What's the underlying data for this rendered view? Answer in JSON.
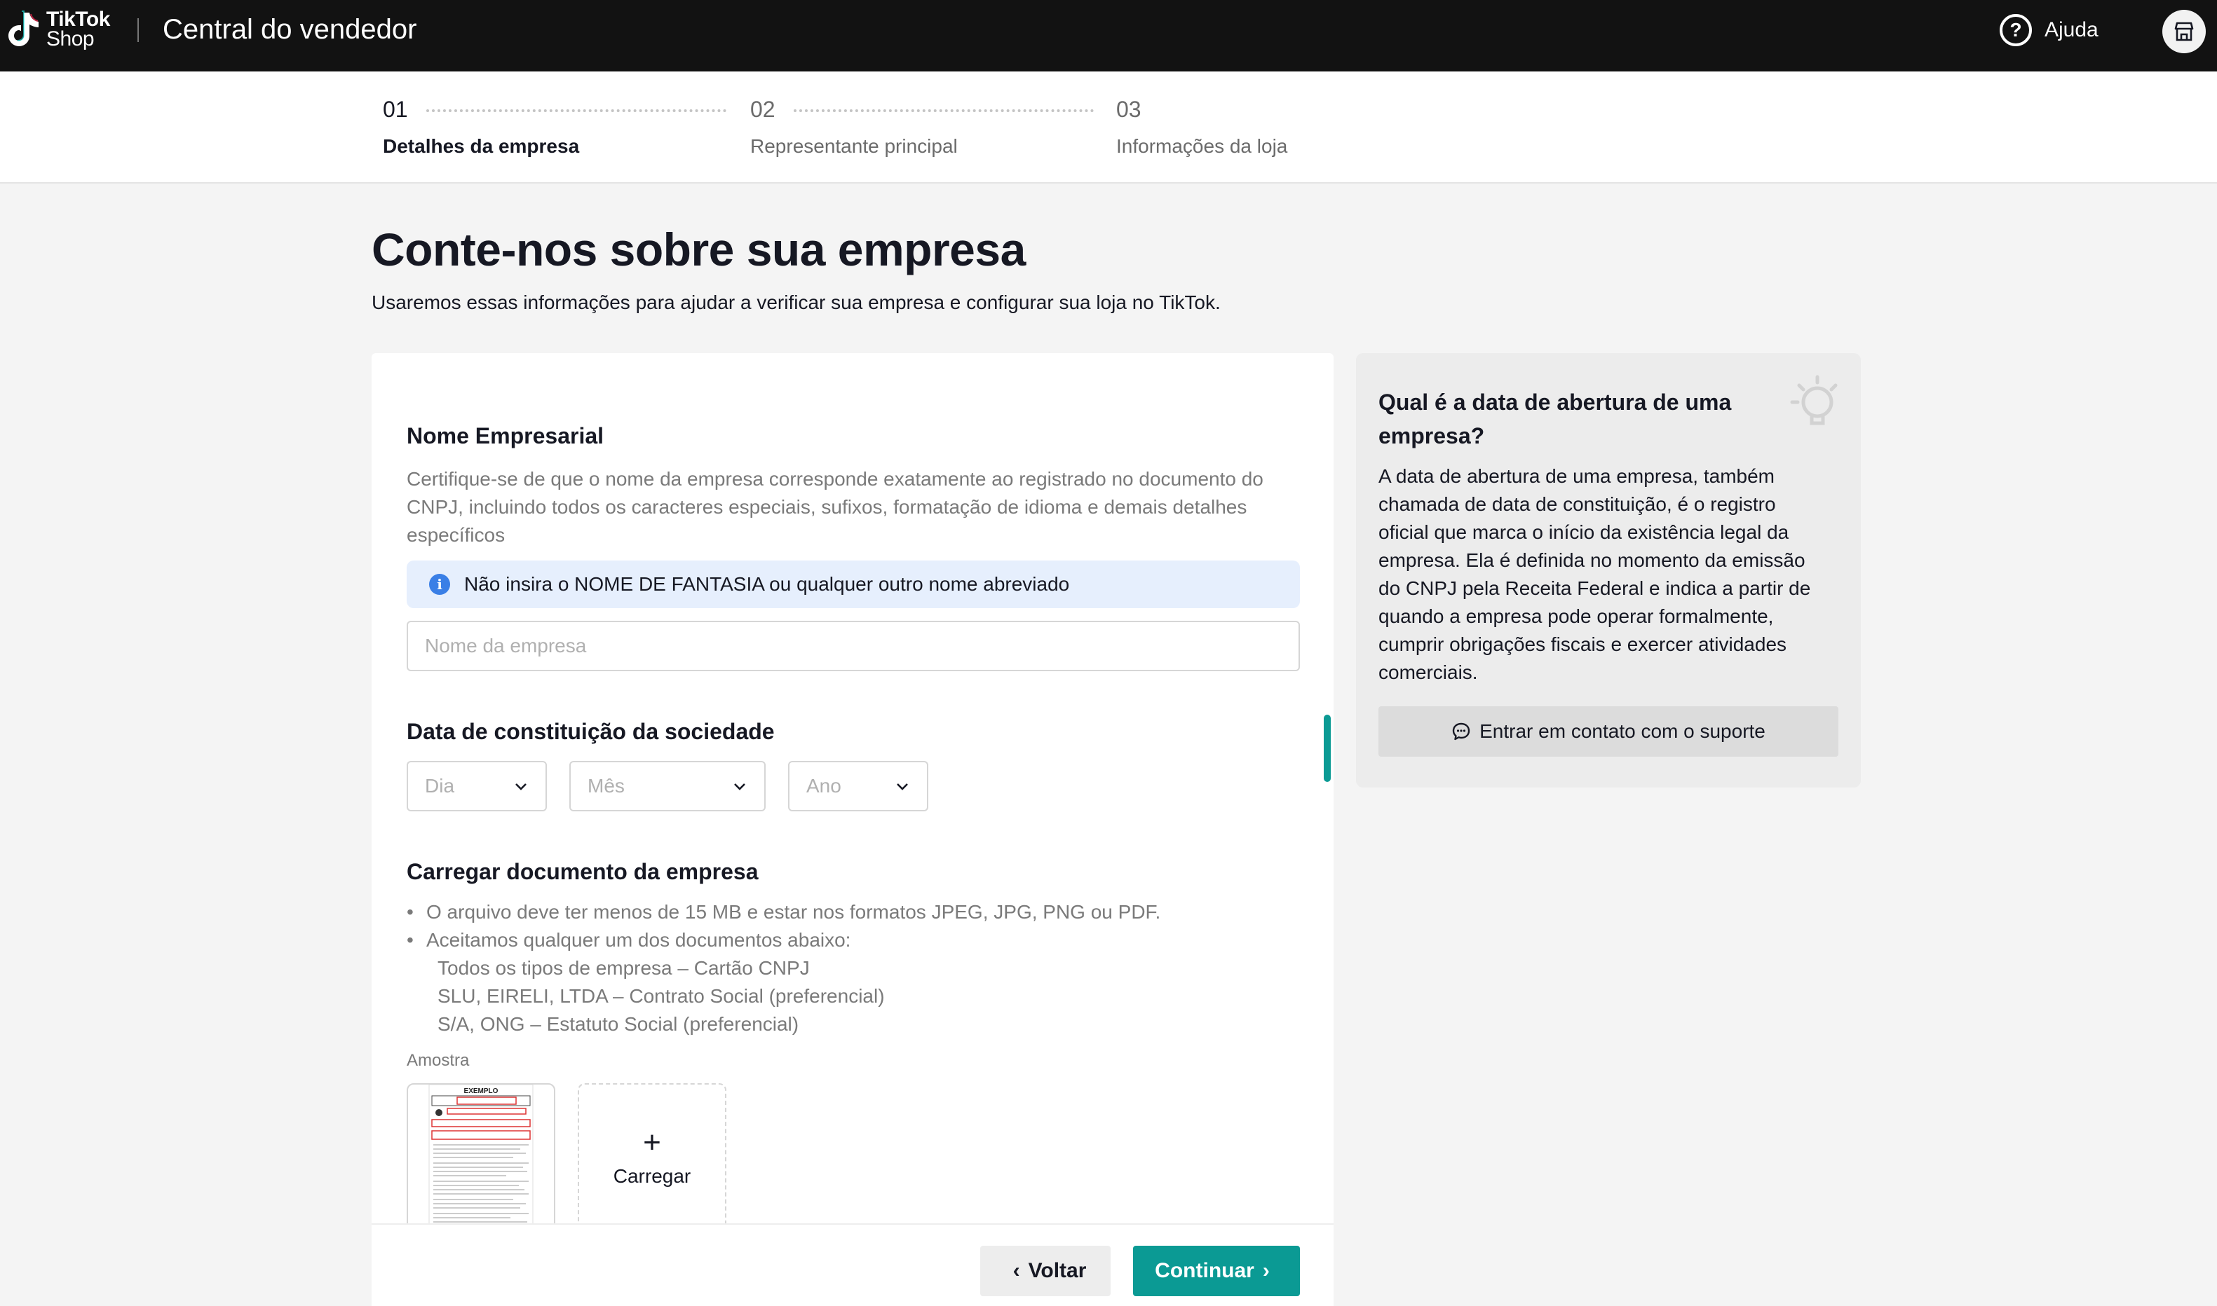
{
  "header": {
    "logo_line1": "TikTok",
    "logo_line2": "Shop",
    "title": "Central do vendedor",
    "help_label": "Ajuda",
    "help_icon": "question-circle-icon",
    "store_icon": "store-icon"
  },
  "stepper": {
    "steps": [
      {
        "num": "01",
        "label": "Detalhes da empresa",
        "active": true
      },
      {
        "num": "02",
        "label": "Representante principal",
        "active": false
      },
      {
        "num": "03",
        "label": "Informações da loja",
        "active": false
      }
    ]
  },
  "page": {
    "title": "Conte-nos sobre sua empresa",
    "subtitle": "Usaremos essas informações para ajudar a verificar sua empresa e configurar sua loja no TikTok."
  },
  "form": {
    "company_name": {
      "title": "Nome Empresarial",
      "description": "Certifique-se de que o nome da empresa corresponde exatamente ao registrado no documento do CNPJ, incluindo todos os caracteres especiais, sufixos, formatação de idioma e demais detalhes específicos",
      "banner": "Não insira o NOME DE FANTASIA ou qualquer outro nome abreviado",
      "placeholder": "Nome da empresa",
      "value": ""
    },
    "incorporation_date": {
      "title": "Data de constituição da sociedade",
      "day_placeholder": "Dia",
      "month_placeholder": "Mês",
      "year_placeholder": "Ano"
    },
    "document": {
      "title": "Carregar documento da empresa",
      "bullet1": "O arquivo deve ter menos de 15 MB e estar nos formatos JPEG, JPG, PNG ou PDF.",
      "bullet2": "Aceitamos qualquer um dos documentos abaixo:",
      "doc_types": [
        "Todos os tipos de empresa – Cartão CNPJ",
        "SLU, EIRELI, LTDA – Contrato Social (preferencial)",
        "S/A, ONG – Estatuto Social (preferencial)"
      ],
      "sample_label": "Amostra",
      "sample_stamp": "EXEMPLO",
      "upload_label": "Carregar"
    }
  },
  "footer": {
    "back_label": "Voltar",
    "next_label": "Continuar"
  },
  "help_card": {
    "title": "Qual é a data de abertura de uma empresa?",
    "body": "A data de abertura de uma empresa, também chamada de data de constituição, é o registro oficial que marca o início da existência legal da empresa. Ela é definida no momento da emissão do CNPJ pela Receita Federal e indica a partir de quando a empresa pode operar formalmente, cumprir obrigações fiscais e exercer atividades comerciais.",
    "support_label": "Entrar em contato com o suporte"
  },
  "colors": {
    "accent": "#0b9a94",
    "header_bg": "#121212",
    "info_banner_bg": "#e6effd",
    "info_icon": "#3a7fe6"
  }
}
